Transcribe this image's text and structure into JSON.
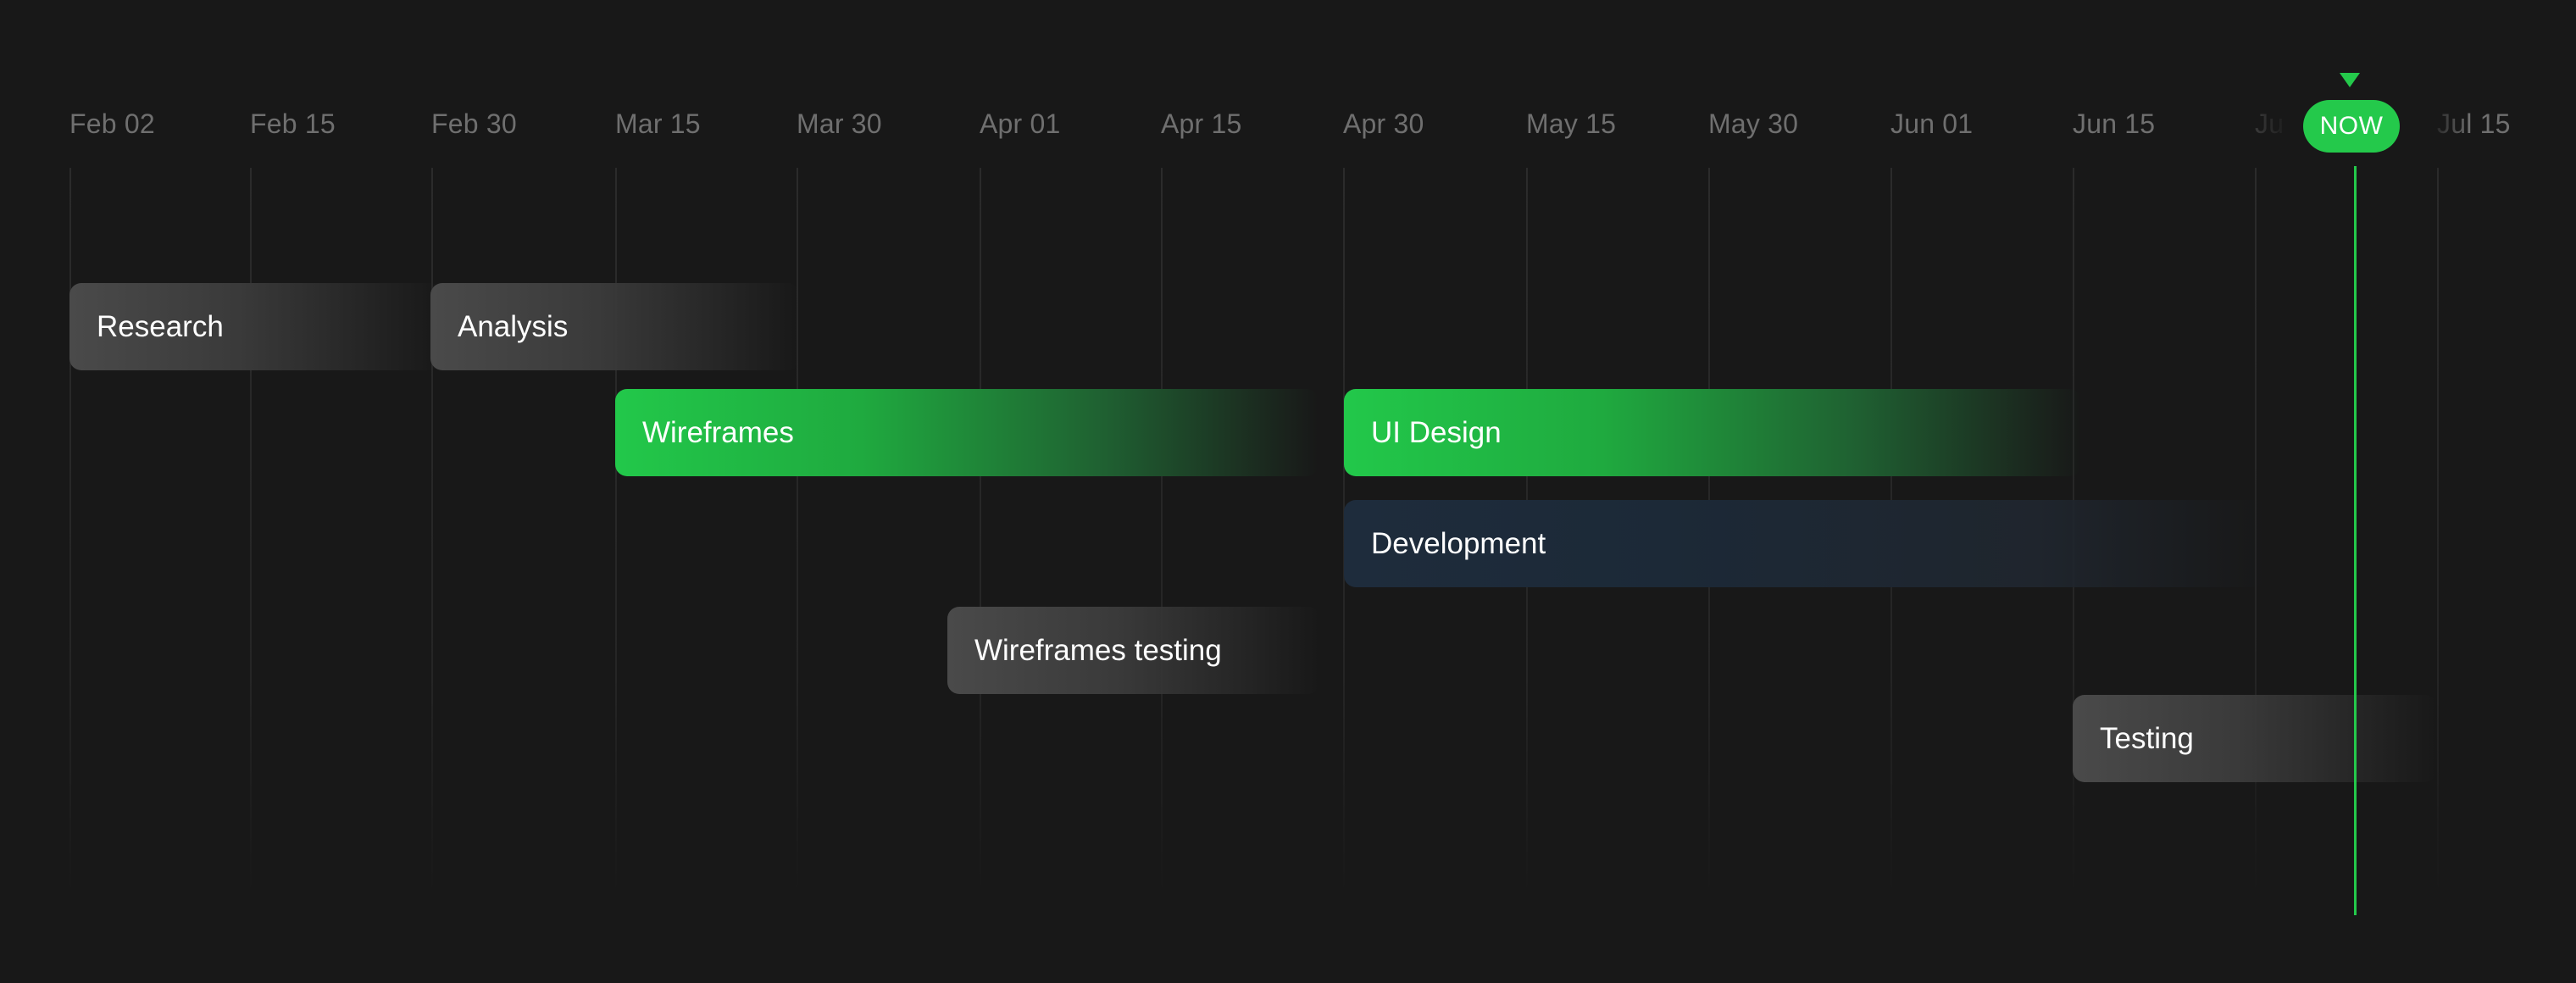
{
  "dates": [
    "Feb 02",
    "Feb 15",
    "Feb 30",
    "Mar 15",
    "Mar 30",
    "Apr 01",
    "Apr 15",
    "Apr 30",
    "May 15",
    "May 30",
    "Jun 01",
    "Jun 15",
    "Ju",
    "Jul 15"
  ],
  "now_label": "NOW",
  "tasks": {
    "research": "Research",
    "analysis": "Analysis",
    "wireframes": "Wireframes",
    "ui_design": "UI Design",
    "development": "Development",
    "wireframes_testing": "Wireframes testing",
    "testing": "Testing"
  },
  "colors": {
    "background": "#181818",
    "accent_green": "#24c94b",
    "neutral_bar": "#4a4a4a",
    "blue_bar": "#1e2c3c"
  }
}
